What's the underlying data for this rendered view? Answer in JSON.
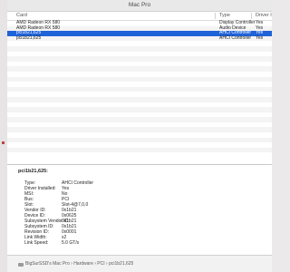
{
  "window": {
    "title": "Mac Pro"
  },
  "table": {
    "headers": {
      "card": "Card",
      "type": "Type",
      "driver": "Driver I"
    },
    "rows": [
      {
        "card": "AMD Radeon RX 580",
        "type": "Display Controller",
        "driver": "Yes"
      },
      {
        "card": "AMD Radeon RX 580",
        "type": "Audio Device",
        "driver": "Yes"
      },
      {
        "card": "pci1b21,625",
        "type": "AHCI Controller",
        "driver": "Yes"
      },
      {
        "card": "pci1b21,625",
        "type": "AHCI Controller",
        "driver": "Yes"
      }
    ],
    "selected_index": 2
  },
  "detail": {
    "title": "pci1b21,625:",
    "properties": [
      {
        "label": "Type:",
        "value": "AHCI Controller"
      },
      {
        "label": "Driver Installed:",
        "value": "Yes"
      },
      {
        "label": "MSI:",
        "value": "No"
      },
      {
        "label": "Bus:",
        "value": "PCI"
      },
      {
        "label": "Slot:",
        "value": "Slot-4@7,0,0"
      },
      {
        "label": "Vendor ID:",
        "value": "0x1b21"
      },
      {
        "label": "Device ID:",
        "value": "0x0625"
      },
      {
        "label": "Subsystem Vendor ID:",
        "value": "0x1b21"
      },
      {
        "label": "Subsystem ID:",
        "value": "0x1b21"
      },
      {
        "label": "Revision ID:",
        "value": "0x0001"
      },
      {
        "label": "Link Width:",
        "value": "x2"
      },
      {
        "label": "Link Speed:",
        "value": "5.0 GT/s"
      }
    ]
  },
  "pathbar": {
    "text": "BigSurSSD's Mac Pro › Hardware › PCI › pci1b21,625"
  },
  "colors": {
    "selection": "#1f63d8",
    "alternate_row": "#f4f4f4"
  }
}
